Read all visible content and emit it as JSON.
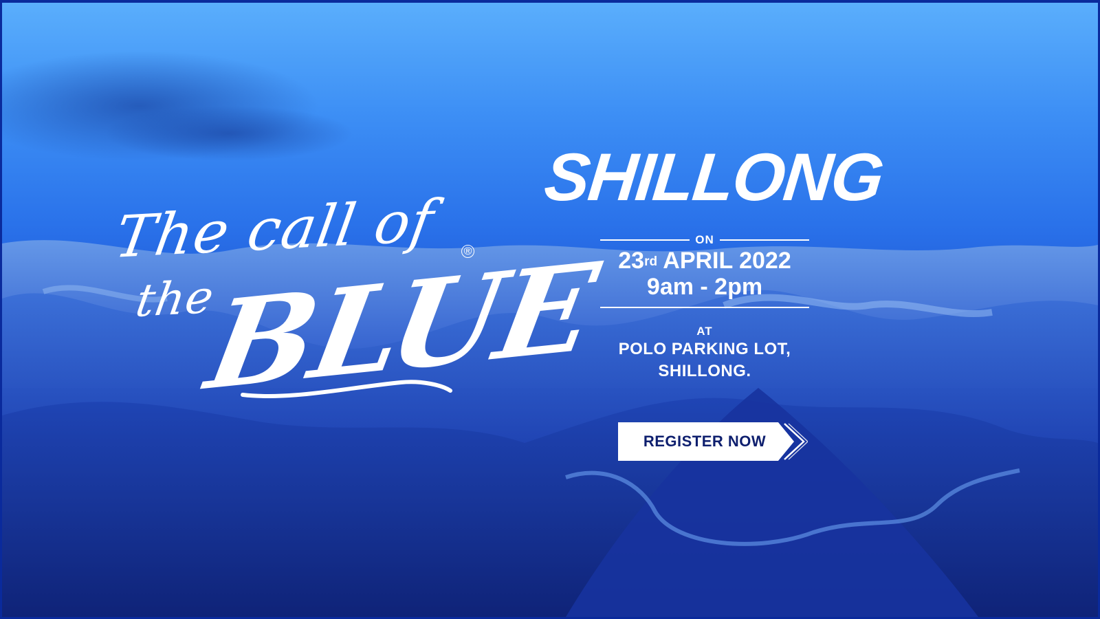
{
  "logo": {
    "line1": "The call of",
    "line2": "the",
    "line3": "BLUE",
    "registered": "®"
  },
  "event": {
    "city": "SHILLONG",
    "on_label": "ON",
    "date_day": "23",
    "date_suffix": "rd",
    "date_rest": "APRIL 2022",
    "time": "9am - 2pm",
    "at_label": "AT",
    "venue_line1": "POLO PARKING LOT,",
    "venue_line2": "SHILLONG."
  },
  "cta": {
    "register_label": "REGISTER NOW"
  },
  "colors": {
    "sky_top": "#5aaefc",
    "deep_blue": "#132a8a",
    "text": "#ffffff",
    "button_text": "#0e1f6e"
  }
}
